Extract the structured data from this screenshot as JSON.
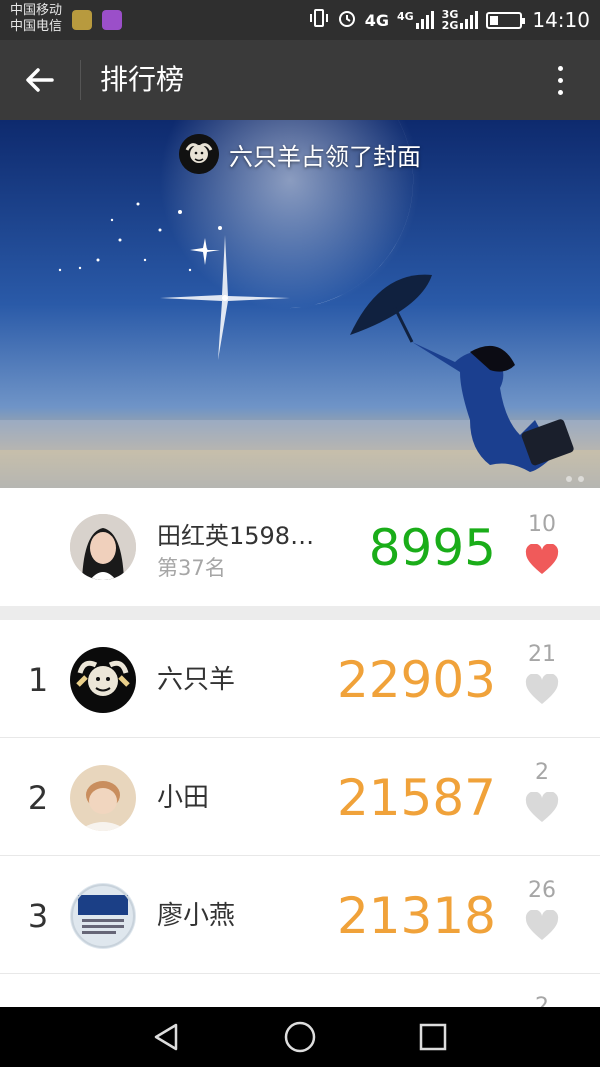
{
  "status_bar": {
    "carrier_1": "中国移动",
    "carrier_2": "中国电信",
    "network_4g": "4G",
    "network_4g_small": "4G",
    "network_3g": "3G",
    "network_2g": "2G",
    "time": "14:10",
    "battery_level": 0.3
  },
  "app_bar": {
    "title": "排行榜",
    "back_icon": "arrow-left-icon",
    "menu_icon": "more-vertical-icon"
  },
  "cover": {
    "caption": "六只羊占领了封面"
  },
  "me": {
    "name": "田红英1598…",
    "rank_text": "第37名",
    "steps": "8995",
    "likes": "10",
    "liked": true
  },
  "leaderboard": [
    {
      "rank": "1",
      "name": "六只羊",
      "steps": "22903",
      "likes": "21"
    },
    {
      "rank": "2",
      "name": "小田",
      "steps": "21587",
      "likes": "2"
    },
    {
      "rank": "3",
      "name": "廖小燕",
      "steps": "21318",
      "likes": "26"
    }
  ],
  "partial_row": {
    "likes": "2"
  },
  "colors": {
    "self_steps": "#1aad19",
    "ranked_steps": "#f0a23a",
    "heart_liked": "#f05a5a",
    "heart_default": "#d9d9d9"
  },
  "nav_bar": {
    "back": "triangle-back-icon",
    "home": "circle-home-icon",
    "recent": "square-recent-icon"
  }
}
